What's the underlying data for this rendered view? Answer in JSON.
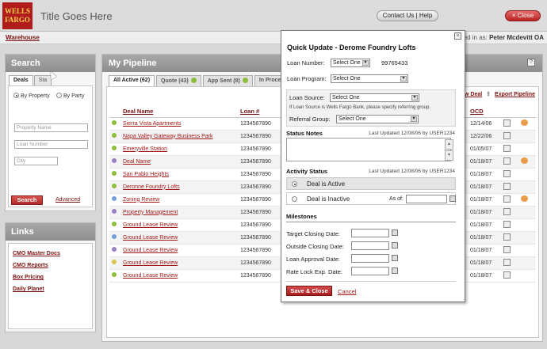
{
  "header": {
    "logo_line1": "WELLS",
    "logo_line2": "FARGO",
    "title": "Title Goes Here",
    "contact_label": "Contact Us",
    "help_label": "Help",
    "close_label": "× Close"
  },
  "subbar": {
    "warehouse": "Warehouse",
    "signed_in_prefix": "gned in as:",
    "user": "Peter Mcdevitt OA"
  },
  "search": {
    "title": "Search",
    "tab_deals": "Deals",
    "tab_status": "Sta",
    "radio_property": "By Property",
    "radio_party": "By Party",
    "property_placeholder": "Property Name",
    "loan_placeholder": "Loan Number",
    "city_placeholder": "City",
    "search_button": "Search",
    "advanced": "Advanced"
  },
  "links": {
    "title": "Links",
    "items": [
      "CMO Master Docs",
      "CMO Reports",
      "Box Pricing",
      "Daily Planet"
    ]
  },
  "pipeline": {
    "title": "My Pipeline",
    "help": "?",
    "tabs": [
      {
        "label": "All Active (62)",
        "active": true
      },
      {
        "label": "Quote (43)",
        "active": false
      },
      {
        "label": "App Sent (8)",
        "active": false
      },
      {
        "label": "In Proce",
        "active": false
      }
    ],
    "view_deal": "ew Deal",
    "export": "Export Pipeline",
    "columns": {
      "deal_name": "Deal Name",
      "loan": "Loan #",
      "ocd": "OCD"
    },
    "rows": [
      {
        "status_color": "#8dbd3c",
        "name": "Sierra Vista Apartments",
        "loan": "1234567890",
        "ocd": "12/14/06",
        "flag": true
      },
      {
        "status_color": "#8dbd3c",
        "name": "Napa Valley Gateway Business Park",
        "loan": "1234567890",
        "ocd": "12/22/06",
        "flag": false
      },
      {
        "status_color": "#8dbd3c",
        "name": "Emeryville Station",
        "loan": "1234567890",
        "ocd": "01/05/07",
        "flag": false
      },
      {
        "status_color": "#9a7fc6",
        "name": "Deal Name",
        "loan": "1234567890",
        "ocd": "01/18/07",
        "flag": true
      },
      {
        "status_color": "#8dbd3c",
        "name": "San Pablo Heights",
        "loan": "1234567890",
        "ocd": "01/18/07",
        "flag": false
      },
      {
        "status_color": "#8dbd3c",
        "name": "Deronne Foundry Lofts",
        "loan": "1234567890",
        "ocd": "01/18/07",
        "flag": false
      },
      {
        "status_color": "#6fa0d8",
        "name": "Zoning Review",
        "loan": "1234567890",
        "ocd": "01/18/07",
        "flag": true
      },
      {
        "status_color": "#9a7fc6",
        "name": "Property Management",
        "loan": "1234567890",
        "ocd": "01/18/07",
        "flag": false
      },
      {
        "status_color": "#8dbd3c",
        "name": "Ground Lease Review",
        "loan": "1234567890",
        "ocd": "01/18/07",
        "flag": false
      },
      {
        "status_color": "#6fa0d8",
        "name": "Ground Lease Review",
        "loan": "1234567890",
        "ocd": "01/18/07",
        "flag": false
      },
      {
        "status_color": "#9a7fc6",
        "name": "Ground Lease Review",
        "loan": "1234567890",
        "ocd": "01/18/07",
        "flag": false
      },
      {
        "status_color": "#d8c64a",
        "name": "Ground Lease Review",
        "loan": "1234567890",
        "ocd": "01/18/07",
        "flag": false
      },
      {
        "status_color": "#8dbd3c",
        "name": "Ground Lease Review",
        "loan": "1234567890",
        "ocd": "01/18/07",
        "flag": false
      }
    ]
  },
  "modal": {
    "close": "×",
    "title": "Quick Update - Derome Foundry Lofts",
    "loan_number_label": "Loan Number:",
    "loan_number_select": "Select One",
    "loan_number_value": "99765433",
    "loan_program_label": "Loan Program:",
    "loan_program_select": "Select One",
    "loan_source_label": "Loan Source:",
    "loan_source_select": "Select One",
    "loan_source_note": "If Loan Source is Wells Fargo Bank, please specify referring group.",
    "referral_label": "Referral Group:",
    "referral_select": "Select One",
    "status_notes_label": "Status Notes",
    "status_notes_updated": "Last Updated 12/08/06 by USER1234",
    "activity_label": "Activity Status",
    "activity_updated": "Last Updated 12/08/06 by USER1234",
    "deal_active": "Deal is Active",
    "deal_inactive": "Deal is Inactive",
    "as_of": "As of:",
    "milestones_label": "Milestones",
    "target_closing": "Target Closing Date:",
    "outside_closing": "Outside Closing Date:",
    "loan_approval": "Loan Approval Date:",
    "rate_lock": "Rate Lock Exp. Date:",
    "save_close": "Save & Close",
    "cancel": "Cancel"
  }
}
